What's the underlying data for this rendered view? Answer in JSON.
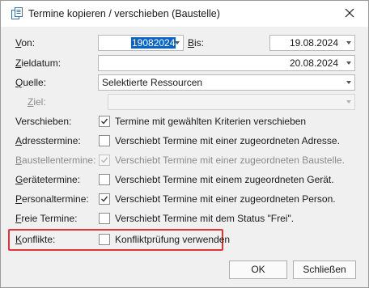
{
  "window": {
    "title": "Termine kopieren / verschieben (Baustelle)"
  },
  "icons": {
    "app": "copy-document-icon",
    "close": "close-icon",
    "dropdown": "chevron-down-icon",
    "check": "checkmark-icon"
  },
  "colors": {
    "selection": "#0a64c8",
    "highlight_border": "#e0333a"
  },
  "form": {
    "von": {
      "label_u": "V",
      "label_rest": "on:",
      "value": "19082024"
    },
    "bis": {
      "label_u": "B",
      "label_rest": "is:",
      "value": "19.08.2024"
    },
    "zieldatum": {
      "label_u": "Z",
      "label_rest": "ieldatum:",
      "value": "20.08.2024"
    },
    "quelle": {
      "label_u": "Q",
      "label_rest": "uelle:",
      "value": "Selektierte Ressourcen"
    },
    "ziel": {
      "label_u": "Z",
      "label_rest": "iel:",
      "value": ""
    }
  },
  "checkboxes": {
    "verschieben": {
      "label_u": "",
      "label_rest": "Verschieben:",
      "text": "Termine mit gewählten Kriterien verschieben",
      "checked": true,
      "enabled": true
    },
    "adresstermine": {
      "label_u": "A",
      "label_rest": "dresstermine:",
      "text": "Verschiebt Termine mit einer zugeordneten Adresse.",
      "checked": false,
      "enabled": true
    },
    "baustellentermine": {
      "label_u": "B",
      "label_rest": "austellentermine:",
      "text": "Verschiebt Termine mit einer zugeordneten Baustelle.",
      "checked": true,
      "enabled": false
    },
    "geraetetermine": {
      "label_u": "G",
      "label_rest": "erätetermine:",
      "text": "Verschiebt Termine mit einem zugeordneten Gerät.",
      "checked": false,
      "enabled": true
    },
    "personaltermine": {
      "label_u": "P",
      "label_rest": "ersonaltermine:",
      "text": "Verschiebt Termine mit einer zugeordneten Person.",
      "checked": true,
      "enabled": true
    },
    "freie": {
      "label_u": "F",
      "label_rest": "reie Termine:",
      "text": "Verschiebt Termine mit dem Status \"Frei\".",
      "checked": false,
      "enabled": true
    },
    "konflikte": {
      "label_u": "K",
      "label_rest": "onflikte:",
      "text": "Konfliktprüfung verwenden",
      "checked": false,
      "enabled": true
    }
  },
  "buttons": {
    "ok": "OK",
    "close": "Schließen"
  }
}
